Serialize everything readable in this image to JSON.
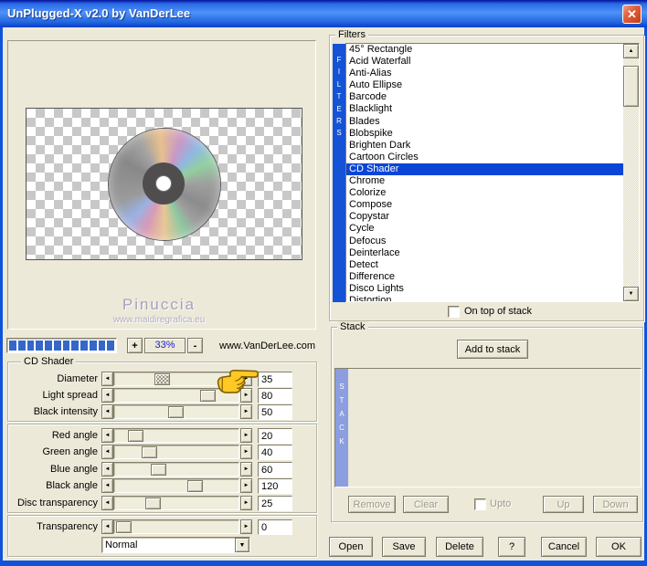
{
  "window": {
    "title": "UnPlugged-X v2.0 by VanDerLee",
    "close_glyph": "✕"
  },
  "preview": {
    "watermark_name": "Pinuccia",
    "watermark_site": "www.maidiregrafica.eu"
  },
  "zoom_bar": {
    "segments": 12,
    "plus": "+",
    "value": "33%",
    "minus": "-",
    "site": "www.VanDerLee.com"
  },
  "shader": {
    "group_title": "CD Shader",
    "blend_mode": "Normal",
    "sliders": [
      {
        "label": "Diameter",
        "value": "35",
        "pct": 36,
        "group": 1,
        "checkered": true
      },
      {
        "label": "Light spread",
        "value": "80",
        "pct": 78,
        "group": 1
      },
      {
        "label": "Black intensity",
        "value": "50",
        "pct": 49,
        "group": 1
      },
      {
        "label": "Red angle",
        "value": "20",
        "pct": 12,
        "group": 2
      },
      {
        "label": "Green angle",
        "value": "40",
        "pct": 24,
        "group": 2
      },
      {
        "label": "Blue angle",
        "value": "60",
        "pct": 33,
        "group": 2
      },
      {
        "label": "Black angle",
        "value": "120",
        "pct": 66,
        "group": 2
      },
      {
        "label": "Disc transparency",
        "value": "25",
        "pct": 28,
        "group": 2
      },
      {
        "label": "Transparency",
        "value": "0",
        "pct": 1,
        "group": 3
      }
    ]
  },
  "filters": {
    "group_title": "Filters",
    "strip": "FILTERS",
    "selected_index": 10,
    "items": [
      "45° Rectangle",
      "Acid Waterfall",
      "Anti-Alias",
      "Auto Ellipse",
      "Barcode",
      "Blacklight",
      "Blades",
      "Blobspike",
      "Brighten Dark",
      "Cartoon Circles",
      "CD Shader",
      "Chrome",
      "Colorize",
      "Compose",
      "Copystar",
      "Cycle",
      "Defocus",
      "Deinterlace",
      "Detect",
      "Difference",
      "Disco Lights",
      "Distortion"
    ],
    "on_top_label": "On top of stack"
  },
  "stack": {
    "group_title": "Stack",
    "strip": "STACK",
    "add_button": "Add to stack",
    "remove": "Remove",
    "clear": "Clear",
    "upto": "Upto",
    "up": "Up",
    "down": "Down"
  },
  "actions": [
    "Open",
    "Save",
    "Delete",
    "?",
    "Cancel",
    "OK"
  ],
  "colors": {
    "border_blue": "#0F52DC",
    "filters_strip": "#1553D6",
    "stack_strip": "#8B9EE0",
    "selection": "#0B45D6",
    "segment": "#3566CA"
  }
}
